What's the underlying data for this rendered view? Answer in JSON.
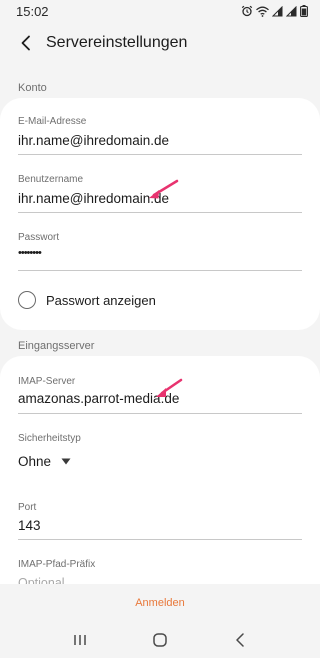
{
  "status_bar": {
    "time": "15:02",
    "icons": [
      "alarm-icon",
      "wifi-icon",
      "signal-icon",
      "signal-icon",
      "battery-icon"
    ]
  },
  "app_bar": {
    "back_icon": "back-arrow-icon",
    "title": "Servereinstellungen"
  },
  "account_section": {
    "header": "Konto",
    "email": {
      "label": "E-Mail-Adresse",
      "value": "ihr.name@ihredomain.de"
    },
    "username": {
      "label": "Benutzername",
      "value": "ihr.name@ihredomain.de"
    },
    "password": {
      "label": "Passwort",
      "value": "••••••••"
    },
    "show_password": {
      "label": "Passwort anzeigen",
      "checked": false
    }
  },
  "incoming_section": {
    "header": "Eingangsserver",
    "imap_server": {
      "label": "IMAP-Server",
      "value": "amazonas.parrot-media.de"
    },
    "security": {
      "label": "Sicherheitstyp",
      "value": "Ohne"
    },
    "port": {
      "label": "Port",
      "value": "143"
    },
    "imap_prefix": {
      "label": "IMAP-Pfad-Präfix",
      "placeholder": "Optional"
    }
  },
  "bottom": {
    "login_label": "Anmelden"
  },
  "colors": {
    "accent": "#e8783a",
    "annotation_arrow": "#e8336f",
    "background": "#f4f4f4",
    "card": "#ffffff"
  },
  "nav_bar": {
    "icons": [
      "recent-apps-icon",
      "home-icon",
      "back-icon"
    ]
  }
}
